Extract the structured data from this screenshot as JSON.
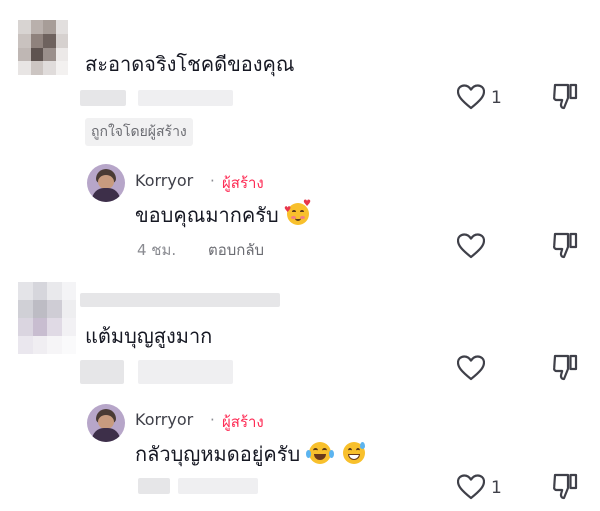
{
  "colors": {
    "creator": "#fe2c55",
    "text": "#161823",
    "meta": "#8a8b91"
  },
  "comments": [
    {
      "text": "สะอาดจริงโชคดีของคุณ",
      "creator_badge": "ถูกใจโดยผู้สร้าง",
      "like_count": "1",
      "reply": {
        "author": "Korryor",
        "separator": "·",
        "author_tag": "ผู้สร้าง",
        "text": "ขอบคุณมากครับ",
        "emoji": "smiling-face-with-hearts",
        "time": "4 ชม.",
        "reply_label": "ตอบกลับ"
      }
    },
    {
      "text": "แต้มบุญสูงมาก",
      "reply": {
        "author": "Korryor",
        "separator": "·",
        "author_tag": "ผู้สร้าง",
        "text": "กลัวบุญหมดอยู่ครับ",
        "emoji": [
          "face-with-tears-of-joy",
          "grinning-face-with-sweat"
        ],
        "like_count": "1"
      }
    }
  ]
}
